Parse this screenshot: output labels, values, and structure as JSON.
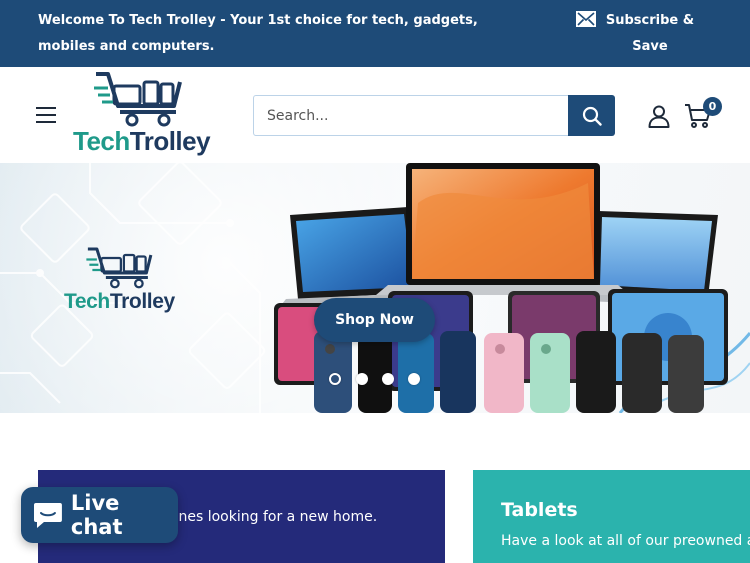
{
  "announcement": {
    "text": "Welcome To Tech Trolley - Your 1st choice for tech, gadgets, mobiles and computers.",
    "subscribe_label": "Subscribe & Save"
  },
  "header": {
    "logo_word_1": "Tech",
    "logo_word_2": "Trolley",
    "search_placeholder": "Search...",
    "cart_count": "0"
  },
  "hero": {
    "logo_word_1": "Tech",
    "logo_word_2": "Trolley",
    "cta_label": "Shop Now",
    "slide_count": 4,
    "active_slide": 1
  },
  "categories": [
    {
      "title": "",
      "description": "Plenty used phones looking for a new home."
    },
    {
      "title": "Tablets",
      "description": "Have a look at all of our preowned and"
    }
  ],
  "livechat": {
    "label": "Live chat"
  },
  "colors": {
    "brand_navy": "#1e4b78",
    "brand_teal": "#1f9a8a",
    "phones_card": "#242a7a",
    "tablets_card": "#2bb3ad"
  }
}
